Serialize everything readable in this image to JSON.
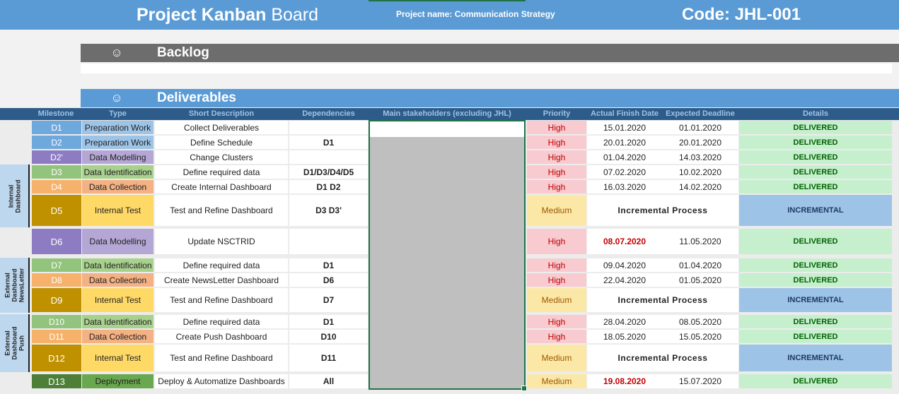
{
  "header": {
    "title_bold": "Project Kanban",
    "title_rest": " Board",
    "project_name": "Project name: Communication Strategy",
    "code": "Code: JHL-001"
  },
  "backlog": {
    "icon": "smiley-neutral-icon",
    "label": "Backlog"
  },
  "deliverables": {
    "icon": "smiley-face-icon",
    "label": "Deliverables"
  },
  "columns": [
    "Milestone",
    "Type",
    "Short Description",
    "Dependencies",
    "Main stakeholders (excluding JHL)",
    "Priority",
    "Actual Finish Date",
    "Expected Deadline",
    "Details"
  ],
  "groups": [
    {
      "label": "Internal\nDashboard"
    },
    {
      "label": "External\nDashboard\nNewsLetter"
    },
    {
      "label": "External\nDashboard\nPush"
    }
  ],
  "rows": [
    {
      "id": "D1",
      "type": "Preparation Work",
      "desc": "Collect Deliverables",
      "dep": "",
      "priority": "High",
      "finish": "15.01.2020",
      "deadline": "01.01.2020",
      "details": "DELIVERED"
    },
    {
      "id": "D2",
      "type": "Preparation Work",
      "desc": "Define Schedule",
      "dep": "D1",
      "priority": "High",
      "finish": "20.01.2020",
      "deadline": "20.01.2020",
      "details": "DELIVERED"
    },
    {
      "id": "D2'",
      "type": "Data Modelling",
      "desc": "Change Clusters",
      "dep": "",
      "priority": "High",
      "finish": "01.04.2020",
      "deadline": "14.03.2020",
      "details": "DELIVERED"
    },
    {
      "id": "D3",
      "type": "Data Identification",
      "desc": "Define required data",
      "dep": "D1/D3/D4/D5",
      "priority": "High",
      "finish": "07.02.2020",
      "deadline": "10.02.2020",
      "details": "DELIVERED"
    },
    {
      "id": "D4",
      "type": "Data Collection",
      "desc": "Create Internal Dashboard",
      "dep": "D1 D2",
      "priority": "High",
      "finish": "16.03.2020",
      "deadline": "14.02.2020",
      "details": "DELIVERED"
    },
    {
      "id": "D5",
      "type": "Internal Test",
      "desc": "Test and Refine Dashboard",
      "dep": "D3 D3'",
      "priority": "Medium",
      "finish": "Incremental Process",
      "deadline": "",
      "details": "INCREMENTAL"
    },
    {
      "id": "D6",
      "type": "Data Modelling",
      "desc": "Update NSCTRID",
      "dep": "",
      "priority": "High",
      "finish": "08.07.2020",
      "deadline": "11.05.2020",
      "details": "DELIVERED"
    },
    {
      "id": "D7",
      "type": "Data Identification",
      "desc": "Define required data",
      "dep": "D1",
      "priority": "High",
      "finish": "09.04.2020",
      "deadline": "01.04.2020",
      "details": "DELIVERED"
    },
    {
      "id": "D8",
      "type": "Data Collection",
      "desc": "Create NewsLetter Dashboard",
      "dep": "D6",
      "priority": "High",
      "finish": "22.04.2020",
      "deadline": "01.05.2020",
      "details": "DELIVERED"
    },
    {
      "id": "D9",
      "type": "Internal Test",
      "desc": "Test and Refine Dashboard",
      "dep": "D7",
      "priority": "Medium",
      "finish": "Incremental Process",
      "deadline": "",
      "details": "INCREMENTAL"
    },
    {
      "id": "D10",
      "type": "Data Identification",
      "desc": "Define required data",
      "dep": "D1",
      "priority": "High",
      "finish": "28.04.2020",
      "deadline": "08.05.2020",
      "details": "DELIVERED"
    },
    {
      "id": "D11",
      "type": "Data Collection",
      "desc": "Create Push Dashboard",
      "dep": "D10",
      "priority": "High",
      "finish": "18.05.2020",
      "deadline": "15.05.2020",
      "details": "DELIVERED"
    },
    {
      "id": "D12",
      "type": "Internal Test",
      "desc": "Test and Refine Dashboard",
      "dep": "D11",
      "priority": "Medium",
      "finish": "Incremental Process",
      "deadline": "",
      "details": "INCREMENTAL"
    },
    {
      "id": "D13",
      "type": "Deployment",
      "desc": "Deploy & Automatize Dashboards",
      "dep": "All",
      "priority": "Medium",
      "finish": "19.08.2020",
      "deadline": "15.07.2020",
      "details": "DELIVERED"
    }
  ],
  "colors": {
    "header_blue": "#5b9bd5",
    "backlog_grey": "#6d6d6d",
    "preparation": "#9dc3e6",
    "modelling": "#b4a7d6",
    "identification": "#a9d18e",
    "collection": "#f4b183",
    "internal_test": "#ffd966",
    "deployment": "#6aa84f",
    "high": "#f8cbd1",
    "medium": "#fce8a6",
    "delivered": "#c6efce",
    "incremental": "#9dc3e6"
  }
}
